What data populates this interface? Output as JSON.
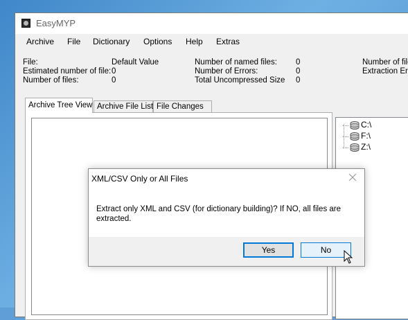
{
  "window": {
    "title": "EasyMYP"
  },
  "menu": [
    "Archive",
    "File",
    "Dictionary",
    "Options",
    "Help",
    "Extras"
  ],
  "info": {
    "col1_labels": [
      "File:",
      "Estimated number of file:",
      "Number of files:"
    ],
    "col1_values": [
      "Default Value",
      "0",
      "0"
    ],
    "col2_labels": [
      "Number of named files:",
      "Number of Errors:",
      "Total Uncompressed Size"
    ],
    "col2_values": [
      "0",
      "0",
      "0"
    ],
    "col3_labels": [
      "Number of files",
      "Extraction Erro"
    ]
  },
  "tabs": [
    "Archive Tree View",
    "Archive File List",
    "File Changes"
  ],
  "drives": [
    "C:\\",
    "F:\\",
    "Z:\\"
  ],
  "dialog": {
    "title": "XML/CSV Only or All Files",
    "message": "Extract only XML and CSV (for dictionary building)? If NO, all files are extracted.",
    "yes_label": "Yes",
    "no_label": "No"
  },
  "colors": {
    "accent": "#0078d7",
    "desktop": "#5f9ed6"
  }
}
